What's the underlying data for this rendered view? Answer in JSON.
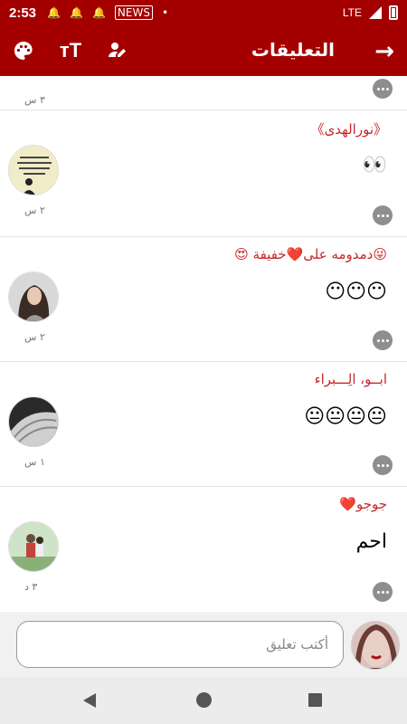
{
  "status_bar": {
    "time": "2:53",
    "icons": [
      "bell-icon",
      "bell-icon",
      "bell-icon",
      "news-icon",
      "dot-icon"
    ],
    "news_badge": "NEWS",
    "network": "LTE"
  },
  "app_bar": {
    "title": "التعليقات",
    "background_color": "#a40000",
    "icons": [
      "back-arrow-icon",
      "edit-profile-icon",
      "text-size-icon",
      "palette-icon"
    ],
    "text_size_glyph": "ᴛT"
  },
  "comments": [
    {
      "name": "",
      "text": "",
      "time": "٣ س"
    },
    {
      "name": "《نورالهدى》",
      "text": "👀",
      "time": "٢ س"
    },
    {
      "name": "😜دمدومه على❤️خفيفة 😍",
      "text": "😶😶😶",
      "time": "٢ س"
    },
    {
      "name": "ابــو، الِـــبراء",
      "text": "😐😐😐😐",
      "time": "١ س"
    },
    {
      "name": "جوجو❤️",
      "text": "احم",
      "time": "٣ د"
    }
  ],
  "composer": {
    "placeholder": "أكتب تعليق"
  },
  "nav_bar": {
    "icons": [
      "nav-back-icon",
      "nav-home-icon",
      "nav-recents-icon"
    ]
  }
}
